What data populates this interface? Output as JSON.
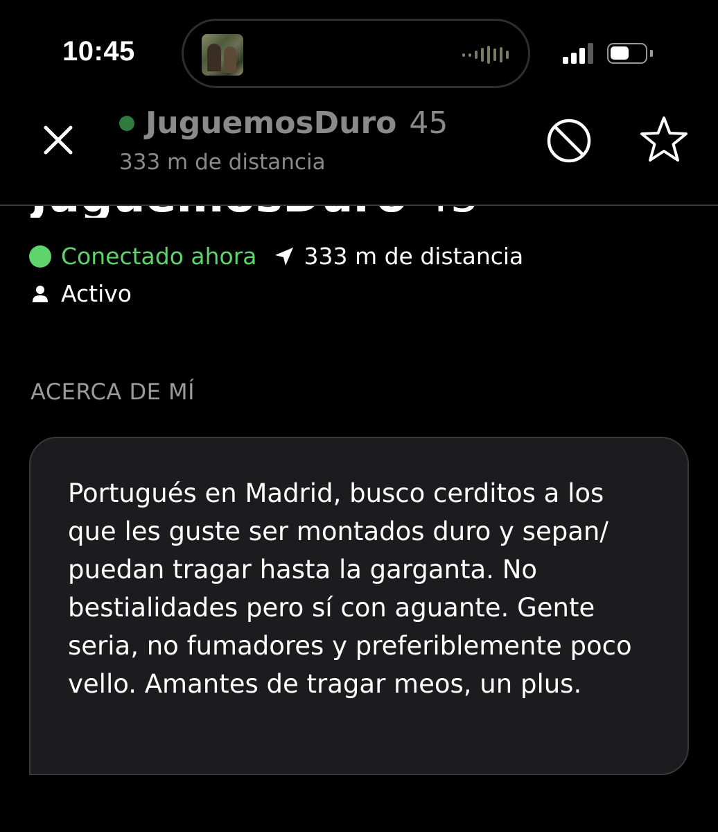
{
  "status_bar": {
    "time": "10:45",
    "signal_bars": 3,
    "signal_bars_total": 4,
    "battery_level": 0.55,
    "now_playing_icon": "waveform-icon",
    "album_art": "album-art-thumbnail"
  },
  "header": {
    "name": "JuguemosDuro",
    "age": "45",
    "distance": "333 m de distancia",
    "close_icon": "close-icon",
    "block_icon": "block-icon",
    "favorite_icon": "star-icon"
  },
  "profile": {
    "name": "JuguemosDuro",
    "age": "45",
    "online_status": "Conectado ahora",
    "distance": "333 m de distancia",
    "activity": "Activo"
  },
  "about": {
    "label": "ACERCA DE MÍ",
    "text": "Portugués en Madrid, busco cerditos a los que les guste ser montados duro y sepan/ puedan tragar hasta la garganta. No bestialidades pero sí con aguante. Gente seria, no fumadores y preferiblemente poco vello. Amantes de tragar meos, un plus."
  },
  "colors": {
    "online_green": "#5fd36c",
    "background": "#000000",
    "card": "#1c1c1e",
    "muted_text": "#8a8a8a"
  }
}
